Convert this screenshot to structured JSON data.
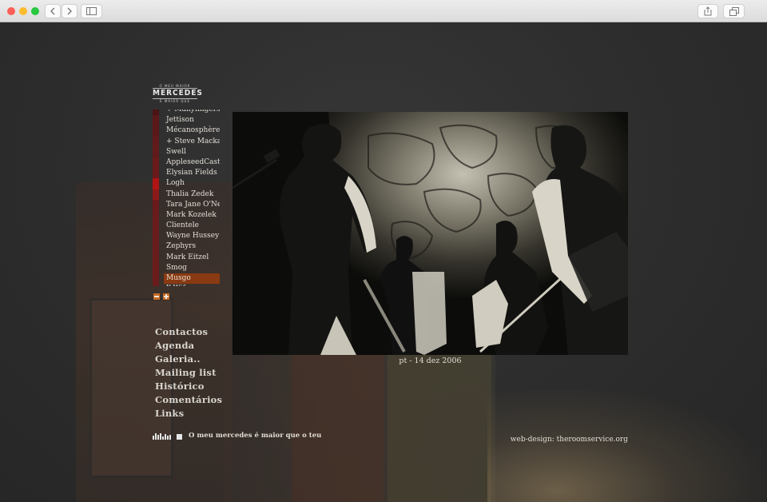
{
  "browser": {
    "back_icon": "chevron-left-icon",
    "forward_icon": "chevron-right-icon",
    "sidebar_icon": "sidebar-icon",
    "share_icon": "share-icon",
    "tabs_icon": "tabs-icon"
  },
  "logo": {
    "top_text": "O MEU MAIOR",
    "name": "MERCEDES",
    "bottom_text": "É MAIOR QUE"
  },
  "artists": {
    "items": [
      "+ Manyfingers",
      "Jettison",
      "Mécanosphère",
      "+ Steve Mackay",
      "Swell",
      "AppleseedCast",
      "Elysian Fields",
      "Logh",
      "Thalia Zedek",
      "Tara Jane O'Neil",
      "Mark Kozelek",
      "Clientele",
      "Wayne Hussey",
      "Zephyrs",
      "Mark Eitzel",
      "Smog",
      "Musgo",
      "X-Wife"
    ],
    "active": "Musgo"
  },
  "nav": {
    "items": [
      "Contactos",
      "Agenda",
      "Galeria..",
      "Mailing list",
      "Histórico",
      "Comentários",
      "Links"
    ]
  },
  "photo": {
    "caption": "pt - 14 dez 2006"
  },
  "footer": {
    "slogan": "O meu mercedes é maior que o teu",
    "credit": "web-design: theroomservice.org"
  },
  "colors": {
    "accent": "#8a3a12",
    "list_bar": "#5a1a1a",
    "text": "#e2ddd4",
    "background": "#2a2a2a"
  }
}
